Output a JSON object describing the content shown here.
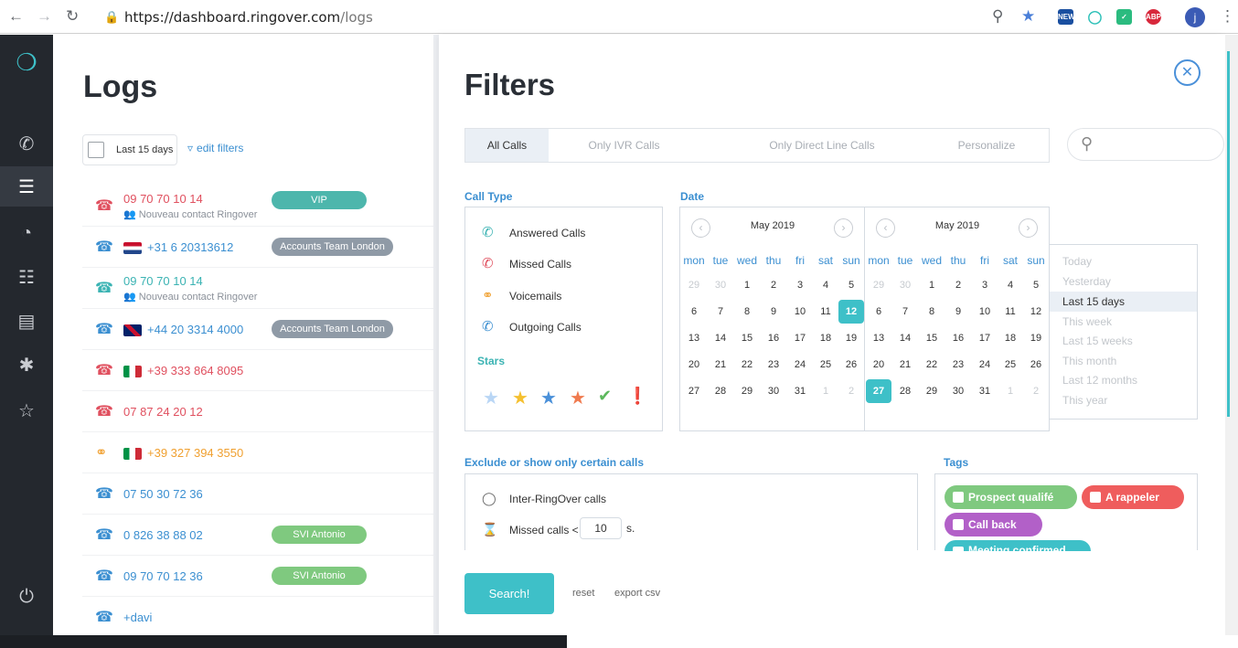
{
  "browser": {
    "url_host": "https://dashboard.ringover.com",
    "url_path": "/logs"
  },
  "sidebar": {
    "items": [
      "logo",
      "phone",
      "logs",
      "stats",
      "settings",
      "terminal",
      "integrations",
      "billing"
    ],
    "active": "logs"
  },
  "logs": {
    "title": "Logs",
    "date_chip": "Last 15 days",
    "edit_filters": "edit filters",
    "rows": [
      {
        "icon": "missed",
        "number": "09 70 70 10 14",
        "sub": "Nouveau contact Ringover",
        "badge": "VIP",
        "badge_color": "#4db6ac",
        "color": "#e0505f"
      },
      {
        "icon": "outgoing",
        "flag": "nl",
        "number": "+31 6 20313612",
        "badge": "Accounts Team London",
        "badge_color": "#8f9aa6",
        "color": "#3b8fd1"
      },
      {
        "icon": "answered",
        "number": "09 70 70 10 14",
        "sub": "Nouveau contact Ringover",
        "color": "#3bb3b3"
      },
      {
        "icon": "outgoing",
        "flag": "uk",
        "number": "+44 20 3314 4000",
        "badge": "Accounts Team London",
        "badge_color": "#8f9aa6",
        "color": "#3b8fd1"
      },
      {
        "icon": "missed",
        "flag": "it",
        "number": "+39 333 864 8095",
        "color": "#e0505f"
      },
      {
        "icon": "missed",
        "number": "07 87 24 20 12",
        "color": "#e0505f"
      },
      {
        "icon": "voicemail",
        "flag": "it",
        "number": "+39 327 394 3550",
        "color": "#f0a030"
      },
      {
        "icon": "outgoing",
        "number": "07 50 30 72 36",
        "color": "#3b8fd1"
      },
      {
        "icon": "outgoing",
        "number": "0 826 38 88 02",
        "badge": "SVI Antonio",
        "badge_color": "#7fc97f",
        "color": "#3b8fd1"
      },
      {
        "icon": "outgoing",
        "number": "09 70 70 12 36",
        "badge": "SVI Antonio",
        "badge_color": "#7fc97f",
        "color": "#3b8fd1"
      },
      {
        "icon": "outgoing",
        "number": "+davi",
        "color": "#3b8fd1"
      }
    ]
  },
  "filters": {
    "title": "Filters",
    "tabs": [
      "All Calls",
      "Only IVR Calls",
      "Only Direct Line Calls",
      "Personalize"
    ],
    "call_type_label": "Call Type",
    "call_types": [
      "Answered Calls",
      "Missed Calls",
      "Voicemails",
      "Outgoing Calls"
    ],
    "stars_label": "Stars",
    "date_label": "Date",
    "months": [
      "May 2019",
      "May 2019"
    ],
    "dow": [
      "mon",
      "tue",
      "wed",
      "thu",
      "fri",
      "sat",
      "sun"
    ],
    "presets": [
      "Today",
      "Yesterday",
      "Last 15 days",
      "This week",
      "Last 15 weeks",
      "This month",
      "Last 12 months",
      "This year"
    ],
    "selected_preset": "Last 15 days",
    "exclude_label": "Exclude or show only certain calls",
    "inter_ringover": "Inter-RingOver calls",
    "missed_calls_prefix": "Missed calls <",
    "missed_calls_value": "10",
    "missed_calls_unit": "s.",
    "tags_label": "Tags",
    "tags": [
      {
        "label": "Prospect qualifé",
        "color": "#7fc97f"
      },
      {
        "label": "A rappeler",
        "color": "#ef5d5d"
      },
      {
        "label": "Call back",
        "color": "#b260c8"
      },
      {
        "label": "Meeting confirmed",
        "color": "#3ec0c8"
      }
    ],
    "search_button": "Search!",
    "reset": "reset",
    "export": "export csv"
  },
  "colors": {
    "accent": "#3ec0c8",
    "link": "#3b8fd1",
    "sidebar": "#24282e"
  }
}
